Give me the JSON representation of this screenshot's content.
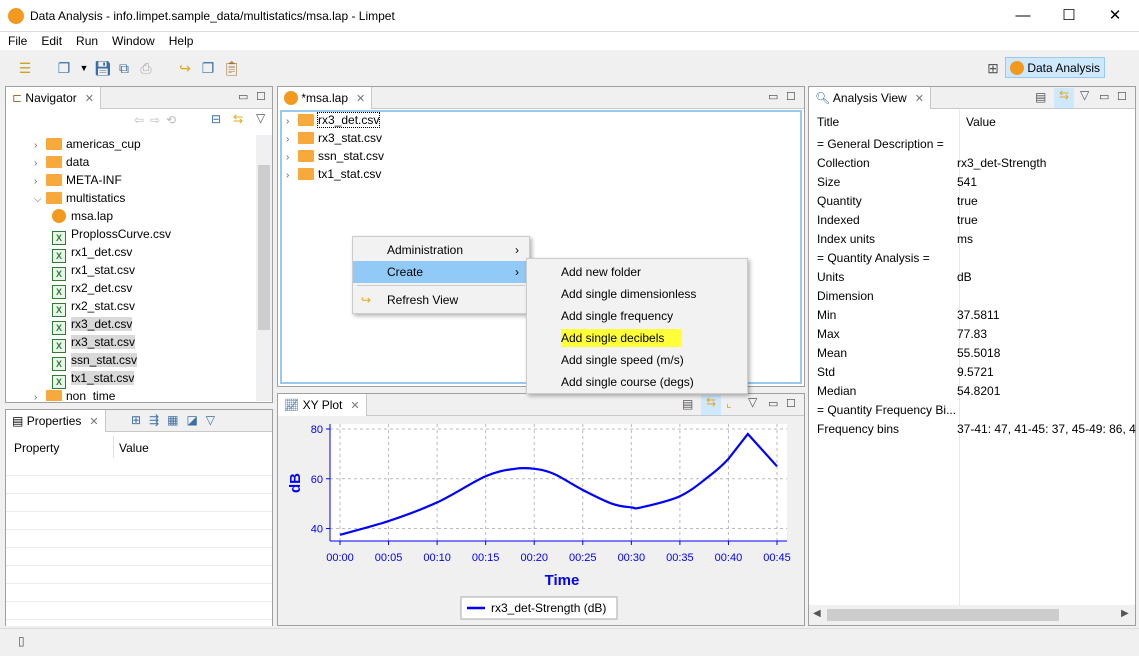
{
  "window": {
    "title": "Data Analysis - info.limpet.sample_data/multistatics/msa.lap - Limpet",
    "controls": [
      "—",
      "☐",
      "✕"
    ]
  },
  "menu": [
    "File",
    "Edit",
    "Run",
    "Window",
    "Help"
  ],
  "perspective": {
    "label": "Data Analysis"
  },
  "navigator": {
    "title": "Navigator",
    "items": [
      {
        "label": "americas_cup",
        "type": "folder",
        "level": 1,
        "expanded": false
      },
      {
        "label": "data",
        "type": "folder",
        "level": 1,
        "expanded": false
      },
      {
        "label": "META-INF",
        "type": "folder",
        "level": 1,
        "expanded": false
      },
      {
        "label": "multistatics",
        "type": "folder",
        "level": 1,
        "expanded": true
      },
      {
        "label": "msa.lap",
        "type": "lap",
        "level": 2
      },
      {
        "label": "ProplossCurve.csv",
        "type": "csv",
        "level": 2
      },
      {
        "label": "rx1_det.csv",
        "type": "csv",
        "level": 2
      },
      {
        "label": "rx1_stat.csv",
        "type": "csv",
        "level": 2
      },
      {
        "label": "rx2_det.csv",
        "type": "csv",
        "level": 2
      },
      {
        "label": "rx2_stat.csv",
        "type": "csv",
        "level": 2
      },
      {
        "label": "rx3_det.csv",
        "type": "csv",
        "level": 2,
        "selected": true
      },
      {
        "label": "rx3_stat.csv",
        "type": "csv",
        "level": 2,
        "selected": true
      },
      {
        "label": "ssn_stat.csv",
        "type": "csv",
        "level": 2,
        "selected": true
      },
      {
        "label": "tx1_stat.csv",
        "type": "csv",
        "level": 2,
        "selected": true
      },
      {
        "label": "non_time",
        "type": "folder",
        "level": 1,
        "expanded": false
      }
    ]
  },
  "properties": {
    "title": "Properties",
    "col_property": "Property",
    "col_value": "Value"
  },
  "editor": {
    "title": "*msa.lap",
    "items": [
      "rx3_det.csv",
      "rx3_stat.csv",
      "ssn_stat.csv",
      "tx1_stat.csv"
    ]
  },
  "context_menu": {
    "items": [
      {
        "label": "Administration",
        "submenu": true
      },
      {
        "label": "Create",
        "submenu": true,
        "highlighted": true
      },
      {
        "label": "Refresh View",
        "submenu": false
      }
    ]
  },
  "submenu": {
    "items": [
      "Add new folder",
      "Add single dimensionless",
      "Add single frequency",
      "Add single decibels",
      "Add single speed (m/s)",
      "Add single course (degs)"
    ],
    "highlighted": "Add single decibels"
  },
  "xyplot": {
    "title": "XY Plot"
  },
  "chart_data": {
    "type": "line",
    "xlabel": "Time",
    "ylabel": "dB",
    "ylim": [
      35,
      82
    ],
    "xlim": [
      "00:00",
      "00:46"
    ],
    "grid": true,
    "legend_placement": "bottom",
    "xticks": [
      "00:00",
      "00:05",
      "00:10",
      "00:15",
      "00:20",
      "00:25",
      "00:30",
      "00:35",
      "00:40",
      "00:45"
    ],
    "yticks": [
      40,
      60,
      80
    ],
    "series": [
      {
        "name": "rx3_det-Strength (dB)",
        "color": "#0000ff",
        "x": [
          "00:00",
          "00:05",
          "00:10",
          "00:15",
          "00:18",
          "00:20",
          "00:22",
          "00:25",
          "00:28",
          "00:30",
          "00:31",
          "00:35",
          "00:38",
          "00:40",
          "00:42",
          "00:45"
        ],
        "y": [
          37.5,
          43,
          50.5,
          61,
          64,
          64,
          62,
          55.5,
          50,
          48.5,
          48.5,
          53,
          61,
          68,
          78,
          65
        ]
      }
    ]
  },
  "analysis": {
    "title": "Analysis View",
    "col_title": "Title",
    "col_value": "Value",
    "rows": [
      [
        "= General Description =",
        ""
      ],
      [
        "Collection",
        "rx3_det-Strength"
      ],
      [
        "Size",
        "541"
      ],
      [
        "Quantity",
        "true"
      ],
      [
        "Indexed",
        "true"
      ],
      [
        "Index units",
        "ms"
      ],
      [
        "= Quantity Analysis =",
        ""
      ],
      [
        "Units",
        "dB"
      ],
      [
        "Dimension",
        ""
      ],
      [
        "Min",
        "37.5811"
      ],
      [
        "Max",
        "77.83"
      ],
      [
        "Mean",
        "55.5018"
      ],
      [
        "Std",
        "9.5721"
      ],
      [
        "Median",
        "54.8201"
      ],
      [
        "= Quantity Frequency Bi...",
        ""
      ],
      [
        "Frequency bins",
        "37-41: 47, 41-45: 37, 45-49: 86, 4"
      ]
    ]
  }
}
